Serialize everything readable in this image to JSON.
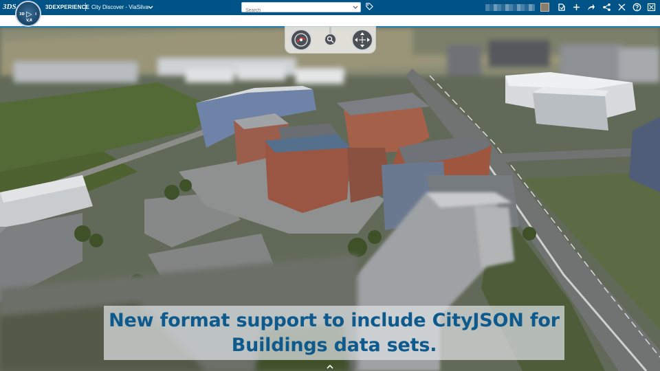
{
  "app": {
    "brand_logo": "3DS",
    "brand": "3DEXPERIENCE",
    "title": "City Discover - ViaSilva",
    "compass_labels": {
      "left": "3D",
      "right": "i",
      "bottom": "V,R"
    }
  },
  "search": {
    "placeholder": "Search",
    "value": ""
  },
  "toolbar_icons": [
    "tag-icon",
    "notification-icon",
    "add-icon",
    "share-icon",
    "network-icon",
    "apps-icon",
    "help-icon",
    "fullscreen-exit-icon"
  ],
  "nav_widget": {
    "zoom_symbol": "🔍"
  },
  "caption": {
    "line1": "New format support to include CityJSON for",
    "line2": "Buildings data sets."
  },
  "colors": {
    "topbar": "#005386",
    "caption_text": "#0e5a8c",
    "accent_line": "#1f7fb6"
  }
}
